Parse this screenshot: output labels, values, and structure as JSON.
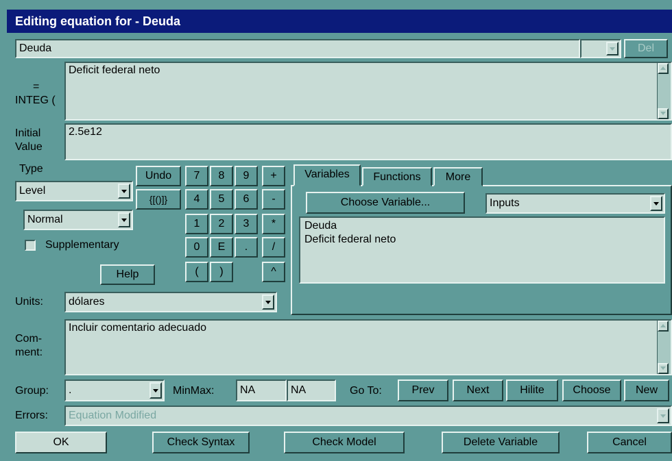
{
  "window": {
    "title": "Editing equation for - Deuda"
  },
  "header": {
    "variable_name": "Deuda",
    "del_label": "Del"
  },
  "equation": {
    "equals_label": "=",
    "integ_label": "INTEG (",
    "text": "Deficit federal neto"
  },
  "initial": {
    "label_line1": "Initial",
    "label_line2": "Value",
    "value": "2.5e12"
  },
  "type": {
    "label": "Type",
    "selected": "Level",
    "subtype": "Normal",
    "supplementary_label": "Supplementary",
    "help_label": "Help"
  },
  "keypad": {
    "undo": "Undo",
    "brackets": "{[()]}",
    "k7": "7",
    "k8": "8",
    "k9": "9",
    "plus": "+",
    "k4": "4",
    "k5": "5",
    "k6": "6",
    "minus": "-",
    "k1": "1",
    "k2": "2",
    "k3": "3",
    "times": "*",
    "k0": "0",
    "kE": "E",
    "dot": ".",
    "divide": "/",
    "lparen": "(",
    "rparen": ")",
    "caret": "^"
  },
  "tabs": {
    "variables": "Variables",
    "functions": "Functions",
    "more": "More"
  },
  "variables_panel": {
    "choose_label": "Choose Variable...",
    "filter": "Inputs",
    "items": [
      "Deuda",
      "Deficit federal neto"
    ]
  },
  "units": {
    "label": "Units:",
    "value": "dólares"
  },
  "comment": {
    "label_line1": "Com-",
    "label_line2": "ment:",
    "text": "Incluir comentario adecuado"
  },
  "group": {
    "label": "Group:",
    "value": ".",
    "minmax_label": "MinMax:",
    "min": "NA",
    "max": "NA",
    "goto_label": "Go To:",
    "prev": "Prev",
    "next": "Next",
    "hilite": "Hilite",
    "choose": "Choose",
    "new": "New"
  },
  "errors": {
    "label": "Errors:",
    "value": "Equation Modified"
  },
  "footer": {
    "ok": "OK",
    "check_syntax": "Check Syntax",
    "check_model": "Check Model",
    "delete_variable": "Delete Variable",
    "cancel": "Cancel"
  }
}
